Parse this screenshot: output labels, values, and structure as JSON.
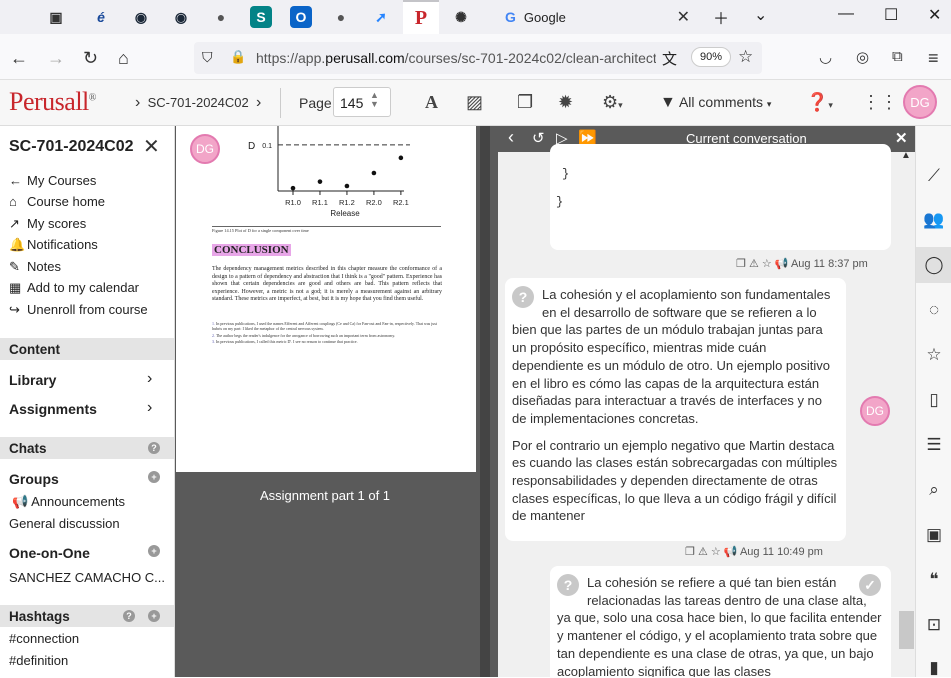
{
  "browser": {
    "tabs": [
      {
        "icon": "tab-list-icon",
        "glyph": "▣"
      },
      {
        "icon": "e-icon",
        "glyph": "é"
      },
      {
        "icon": "steam-icon",
        "glyph": "◉"
      },
      {
        "icon": "steam-icon-2",
        "glyph": "◉"
      },
      {
        "icon": "github-icon",
        "glyph": "●"
      },
      {
        "icon": "sharepoint-icon",
        "glyph": "S"
      },
      {
        "icon": "outlook-icon",
        "glyph": "O"
      },
      {
        "icon": "github-icon-2",
        "glyph": "●"
      },
      {
        "icon": "jira-icon",
        "glyph": "➚"
      },
      {
        "icon": "perusall-icon",
        "glyph": "P"
      },
      {
        "icon": "openai-icon",
        "glyph": "✺"
      }
    ],
    "google_tab_title": "Google",
    "url_prefix": "https://app.",
    "url_domain": "perusall.com",
    "url_suffix": "/courses/sc-701-2024c02/clean-architect",
    "zoom": "90%"
  },
  "app": {
    "logo": "Perusall",
    "logo_mark": "®",
    "breadcrumb": "SC-701-2024C02",
    "page_label": "Page",
    "page_number": "145",
    "filter_label": "All comments",
    "user_initials": "DG"
  },
  "sidebar": {
    "course_title": "SC-701-2024C02",
    "links": [
      {
        "icon": "←",
        "label": "My Courses"
      },
      {
        "icon": "⌂",
        "label": "Course home"
      },
      {
        "icon": "↗",
        "label": "My scores"
      },
      {
        "icon": "🔔",
        "label": "Notifications"
      },
      {
        "icon": "✎",
        "label": "Notes"
      },
      {
        "icon": "▦",
        "label": "Add to my calendar"
      },
      {
        "icon": "↪",
        "label": "Unenroll from course"
      }
    ],
    "content_header": "Content",
    "library": "Library",
    "assignments": "Assignments",
    "chats_header": "Chats",
    "groups": "Groups",
    "announcements": "Announcements",
    "general": "General discussion",
    "one_on_one": "One-on-One",
    "contact": "SANCHEZ CAMACHO C...",
    "hashtags_header": "Hashtags",
    "hashtags": [
      "#connection",
      "#definition"
    ]
  },
  "document": {
    "chart_data": {
      "type": "scatter",
      "categories": [
        "R1.0",
        "R1.1",
        "R1.2",
        "R2.0",
        "R2.1"
      ],
      "values": [
        -0.1,
        -0.07,
        -0.09,
        -0.03,
        0.04
      ],
      "xlabel": "Release",
      "ylabel": "D",
      "reference_line": 0.1,
      "reference_label": "0.1"
    },
    "figure_caption": "Figure 14.15 Plot of D for a single component over time",
    "heading": "CONCLUSION",
    "body": "The dependency management metrics described in this chapter measure the conformance of a design to a pattern of dependency and abstraction that I think is a \"good\" pattern. Experience has shown that certain dependencies are good and others are bad. This pattern reflects that experience. However, a metric is not a god; it is merely a measurement against an arbitrary standard. These metrics are imperfect, at best, but it is my hope that you find them useful.",
    "footnotes": [
      "In previous publications, I used the names Efferent and Afferent couplings (Ce and Ca) for Fan-out and Fan-in, respectively. That was just hubris on my part: I liked the metaphor of the central nervous system.",
      "The author begs the reader's indulgence for the arrogance of borrowing such an important term from astronomy.",
      "In previous publications, I called this metric D'. I see no reason to continue that practice."
    ],
    "part_label": "Assignment part 1 of 1"
  },
  "conversation": {
    "title": "Current conversation",
    "code_lines": [
      "}",
      "}"
    ],
    "msg1_meta": "Aug 11 8:37 pm",
    "msg2_p1": "La cohesión y el acoplamiento son fundamentales en el desarrollo de software que se refieren a lo bien que las partes de un módulo trabajan juntas para un propósito específico, mientras mide cuán dependiente es un módulo de otro. Un ejemplo positivo en el libro es cómo las capas de la arquitectura están diseñadas para interactuar a través de interfaces y no de implementaciones concretas.",
    "msg2_p2": "Por el contrario un ejemplo negativo que Martin destaca es cuando las clases están sobrecargadas con múltiples responsabilidades y dependen directamente de otras clases específicas, lo que lleva a un código frágil y difícil de mantener",
    "msg2_meta": "Aug 11 10:49 pm",
    "msg3": "La cohesión se refiere a qué tan bien están relacionadas las tareas dentro de una clase alta, ya que, solo una cosa hace bien, lo que facilita entender y mantener el código, y el acoplamiento trata sobre que tan dependiente es una clase de otras, ya que, un bajo acoplamiento significa que las clases"
  },
  "colors": {
    "brand": "#c8262c",
    "avatar": "#f2a5c8",
    "highlight": "#e8a6e8"
  }
}
